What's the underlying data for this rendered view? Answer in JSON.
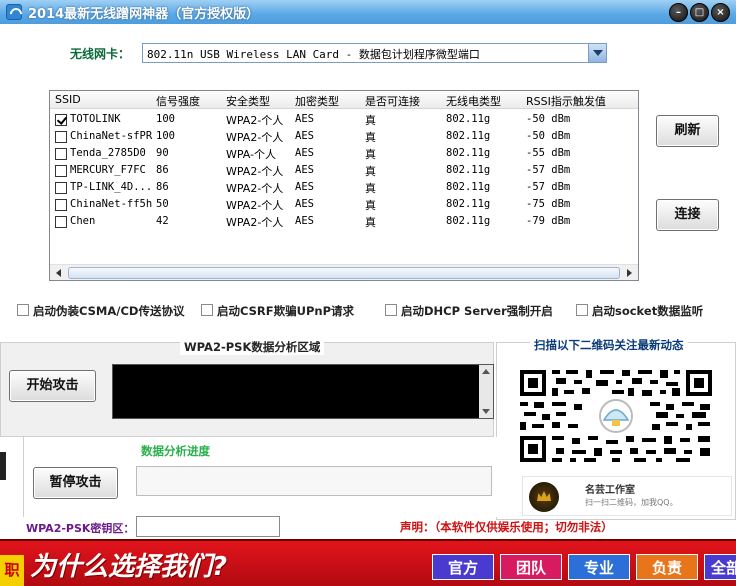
{
  "window": {
    "title": "2014最新无线蹭网神器（官方授权版）",
    "min_label": "–",
    "max_label": "□",
    "close_label": "×"
  },
  "nic": {
    "label": "无线网卡：",
    "value": "802.11n USB Wireless LAN Card - 数据包计划程序微型端口"
  },
  "list": {
    "columns": [
      "SSID",
      "信号强度",
      "安全类型",
      "加密类型",
      "是否可连接",
      "无线电类型",
      "RSSI指示触发值"
    ],
    "rows": [
      {
        "checked": true,
        "ssid": "TOTOLINK",
        "signal": "100",
        "security": "WPA2-个人",
        "cipher": "AES",
        "connectable": "真",
        "radio": "802.11g",
        "rssi": "-50 dBm"
      },
      {
        "checked": false,
        "ssid": "ChinaNet-sfPR",
        "signal": "100",
        "security": "WPA2-个人",
        "cipher": "AES",
        "connectable": "真",
        "radio": "802.11g",
        "rssi": "-50 dBm"
      },
      {
        "checked": false,
        "ssid": "Tenda_2785D0",
        "signal": "90",
        "security": "WPA-个人",
        "cipher": "AES",
        "connectable": "真",
        "radio": "802.11g",
        "rssi": "-55 dBm"
      },
      {
        "checked": false,
        "ssid": "MERCURY_F7FC",
        "signal": "86",
        "security": "WPA2-个人",
        "cipher": "AES",
        "connectable": "真",
        "radio": "802.11g",
        "rssi": "-57 dBm"
      },
      {
        "checked": false,
        "ssid": "TP-LINK_4D...",
        "signal": "86",
        "security": "WPA2-个人",
        "cipher": "AES",
        "connectable": "真",
        "radio": "802.11g",
        "rssi": "-57 dBm"
      },
      {
        "checked": false,
        "ssid": "ChinaNet-ff5h",
        "signal": "50",
        "security": "WPA2-个人",
        "cipher": "AES",
        "connectable": "真",
        "radio": "802.11g",
        "rssi": "-75 dBm"
      },
      {
        "checked": false,
        "ssid": "Chen",
        "signal": "42",
        "security": "WPA2-个人",
        "cipher": "AES",
        "connectable": "真",
        "radio": "802.11g",
        "rssi": "-79 dBm"
      }
    ]
  },
  "buttons": {
    "refresh": "刷新",
    "connect": "连接",
    "start_attack": "开始攻击",
    "pause_attack": "暂停攻击"
  },
  "options": [
    {
      "label": "启动伪装CSMA/CD传送协议",
      "checked": false
    },
    {
      "label": "启动CSRF欺骗UPnP请求",
      "checked": false
    },
    {
      "label": "启动DHCP Server强制开启",
      "checked": false
    },
    {
      "label": "启动socket数据监听",
      "checked": false
    }
  ],
  "analysis": {
    "title": "WPA2-PSK数据分析区域",
    "progress_label": "数据分析进度"
  },
  "qr": {
    "title": "扫描以下二维码关注最新动态",
    "studio_name": "名芸工作室",
    "studio_sub": "扫一扫二维码，加我QQ。"
  },
  "key": {
    "label": "WPA2-PSK密钥区：",
    "value": ""
  },
  "disclaimer": "声明：（本软件仅供娱乐使用；切勿非法）",
  "banner": {
    "left_fragment": "职",
    "slogan": "为什么选择我们?",
    "tabs": [
      "官方",
      "团队",
      "专业",
      "负责",
      "全部"
    ]
  }
}
